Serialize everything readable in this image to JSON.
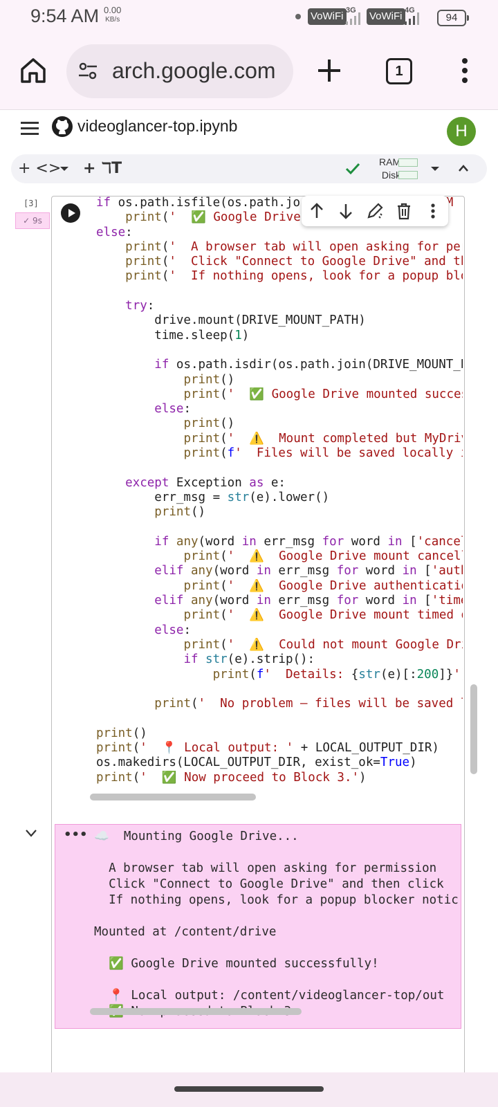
{
  "status_bar": {
    "time": "9:54 AM",
    "speed": "0.00",
    "speed_unit": "KB/s",
    "vowifi1": "VoWiFi",
    "net1": "3G",
    "vowifi2": "VoWiFi",
    "net2": "4G",
    "battery": "94"
  },
  "browser": {
    "url": "arch.google.com",
    "tab_count": "1"
  },
  "colab": {
    "filename": "videoglancer-top.ipynb",
    "avatar": "H",
    "toolbar": {
      "add_code": "+ <>",
      "add_text": "+ ℸT",
      "ram_label": "RAM",
      "disk_label": "Disk"
    },
    "cell": {
      "number": "[3]",
      "exec_time": "✓ 9s"
    },
    "output_lines": [
      "☁️  Mounting Google Drive...",
      "",
      "  A browser tab will open asking for permission",
      "  Click \"Connect to Google Drive\" and then click",
      "  If nothing opens, look for a popup blocker notic",
      "",
      "Mounted at /content/drive",
      "",
      "  ✅ Google Drive mounted successfully!",
      "",
      "  📍 Local output: /content/videoglancer-top/out",
      "  ✅ Now proceed to Block 3."
    ]
  },
  "code_lines": [
    [
      [
        "kw",
        "if "
      ],
      [
        "",
        "os.path.isfile(os.path.jo"
      ],
      [
        "",
        "                   "
      ],
      [
        "st",
        "'M"
      ]
    ],
    [
      [
        "",
        "    "
      ],
      [
        "fn",
        "print"
      ],
      [
        "",
        "("
      ],
      [
        "st",
        "'  ✅ Google Drive"
      ],
      [
        "",
        "            "
      ],
      [
        "st",
        ")"
      ]
    ],
    [
      [
        "kw",
        "else"
      ],
      [
        "",
        ":"
      ]
    ],
    [
      [
        "",
        "    "
      ],
      [
        "fn",
        "print"
      ],
      [
        "",
        "("
      ],
      [
        "st",
        "'  A browser tab will open asking for per"
      ]
    ],
    [
      [
        "",
        "    "
      ],
      [
        "fn",
        "print"
      ],
      [
        "",
        "("
      ],
      [
        "st",
        "'  Click \"Connect to Google Drive\" and th"
      ]
    ],
    [
      [
        "",
        "    "
      ],
      [
        "fn",
        "print"
      ],
      [
        "",
        "("
      ],
      [
        "st",
        "'  If nothing opens, look for a popup blo"
      ]
    ],
    [
      [
        "",
        ""
      ]
    ],
    [
      [
        "",
        "    "
      ],
      [
        "kw",
        "try"
      ],
      [
        "",
        ":"
      ]
    ],
    [
      [
        "",
        "        drive.mount(DRIVE_MOUNT_PATH)"
      ]
    ],
    [
      [
        "",
        "        time.sleep("
      ],
      [
        "nu",
        "1"
      ],
      [
        "",
        ")"
      ]
    ],
    [
      [
        "",
        ""
      ]
    ],
    [
      [
        "",
        "        "
      ],
      [
        "kw",
        "if "
      ],
      [
        "",
        "os.path.isdir(os.path.join(DRIVE_MOUNT_P"
      ]
    ],
    [
      [
        "",
        "            "
      ],
      [
        "fn",
        "print"
      ],
      [
        "",
        "()"
      ]
    ],
    [
      [
        "",
        "            "
      ],
      [
        "fn",
        "print"
      ],
      [
        "",
        "("
      ],
      [
        "st",
        "'  ✅ Google Drive mounted succes"
      ]
    ],
    [
      [
        "",
        "        "
      ],
      [
        "kw",
        "else"
      ],
      [
        "",
        ":"
      ]
    ],
    [
      [
        "",
        "            "
      ],
      [
        "fn",
        "print"
      ],
      [
        "",
        "()"
      ]
    ],
    [
      [
        "",
        "            "
      ],
      [
        "fn",
        "print"
      ],
      [
        "",
        "("
      ],
      [
        "st",
        "'  ⚠️  Mount completed but MyDriv"
      ]
    ],
    [
      [
        "",
        "            "
      ],
      [
        "fn",
        "print"
      ],
      [
        "",
        "("
      ],
      [
        "ct",
        "f"
      ],
      [
        "st",
        "'  Files will be saved locally i"
      ]
    ],
    [
      [
        "",
        ""
      ]
    ],
    [
      [
        "",
        "    "
      ],
      [
        "kw",
        "except "
      ],
      [
        "",
        "Exception "
      ],
      [
        "kw",
        "as "
      ],
      [
        "",
        "e:"
      ]
    ],
    [
      [
        "",
        "        err_msg = "
      ],
      [
        "bi",
        "str"
      ],
      [
        "",
        "(e).lower()"
      ]
    ],
    [
      [
        "",
        "        "
      ],
      [
        "fn",
        "print"
      ],
      [
        "",
        "()"
      ]
    ],
    [
      [
        "",
        ""
      ]
    ],
    [
      [
        "",
        "        "
      ],
      [
        "kw",
        "if "
      ],
      [
        "fn",
        "any"
      ],
      [
        "",
        "(word "
      ],
      [
        "kw",
        "in "
      ],
      [
        "",
        "err_msg "
      ],
      [
        "kw",
        "for "
      ],
      [
        "",
        "word "
      ],
      [
        "kw",
        "in "
      ],
      [
        "",
        "["
      ],
      [
        "st",
        "'cancel"
      ]
    ],
    [
      [
        "",
        "            "
      ],
      [
        "fn",
        "print"
      ],
      [
        "",
        "("
      ],
      [
        "st",
        "'  ⚠️  Google Drive mount cancell"
      ]
    ],
    [
      [
        "",
        "        "
      ],
      [
        "kw",
        "elif "
      ],
      [
        "fn",
        "any"
      ],
      [
        "",
        "(word "
      ],
      [
        "kw",
        "in "
      ],
      [
        "",
        "err_msg "
      ],
      [
        "kw",
        "for "
      ],
      [
        "",
        "word "
      ],
      [
        "kw",
        "in "
      ],
      [
        "",
        "["
      ],
      [
        "st",
        "'auth"
      ]
    ],
    [
      [
        "",
        "            "
      ],
      [
        "fn",
        "print"
      ],
      [
        "",
        "("
      ],
      [
        "st",
        "'  ⚠️  Google Drive authenticatio"
      ]
    ],
    [
      [
        "",
        "        "
      ],
      [
        "kw",
        "elif "
      ],
      [
        "fn",
        "any"
      ],
      [
        "",
        "(word "
      ],
      [
        "kw",
        "in "
      ],
      [
        "",
        "err_msg "
      ],
      [
        "kw",
        "for "
      ],
      [
        "",
        "word "
      ],
      [
        "kw",
        "in "
      ],
      [
        "",
        "["
      ],
      [
        "st",
        "'time"
      ]
    ],
    [
      [
        "",
        "            "
      ],
      [
        "fn",
        "print"
      ],
      [
        "",
        "("
      ],
      [
        "st",
        "'  ⚠️  Google Drive mount timed o"
      ]
    ],
    [
      [
        "",
        "        "
      ],
      [
        "kw",
        "else"
      ],
      [
        "",
        ":"
      ]
    ],
    [
      [
        "",
        "            "
      ],
      [
        "fn",
        "print"
      ],
      [
        "",
        "("
      ],
      [
        "st",
        "'  ⚠️  Could not mount Google Dri"
      ]
    ],
    [
      [
        "",
        "            "
      ],
      [
        "kw",
        "if "
      ],
      [
        "bi",
        "str"
      ],
      [
        "",
        "(e).strip():"
      ]
    ],
    [
      [
        "",
        "                "
      ],
      [
        "fn",
        "print"
      ],
      [
        "",
        "("
      ],
      [
        "ct",
        "f"
      ],
      [
        "st",
        "'  Details: "
      ],
      [
        "",
        "{"
      ],
      [
        "bi",
        "str"
      ],
      [
        "",
        "(e)[:"
      ],
      [
        "nu",
        "200"
      ],
      [
        "",
        "]}"
      ],
      [
        "st",
        "')"
      ]
    ],
    [
      [
        "",
        ""
      ]
    ],
    [
      [
        "",
        "        "
      ],
      [
        "fn",
        "print"
      ],
      [
        "",
        "("
      ],
      [
        "st",
        "'  No problem — files will be saved l"
      ]
    ],
    [
      [
        "",
        ""
      ]
    ],
    [
      [
        "fn",
        "print"
      ],
      [
        "",
        "()"
      ]
    ],
    [
      [
        "fn",
        "print"
      ],
      [
        "",
        "("
      ],
      [
        "st",
        "'  📍 Local output: '"
      ],
      [
        "",
        " + LOCAL_OUTPUT_DIR)"
      ]
    ],
    [
      [
        "",
        "os.makedirs(LOCAL_OUTPUT_DIR, exist_ok="
      ],
      [
        "ct",
        "True"
      ],
      [
        "",
        ")"
      ]
    ],
    [
      [
        "fn",
        "print"
      ],
      [
        "",
        "("
      ],
      [
        "st",
        "'  ✅ Now proceed to Block 3.'"
      ],
      [
        "",
        ")"
      ]
    ]
  ]
}
